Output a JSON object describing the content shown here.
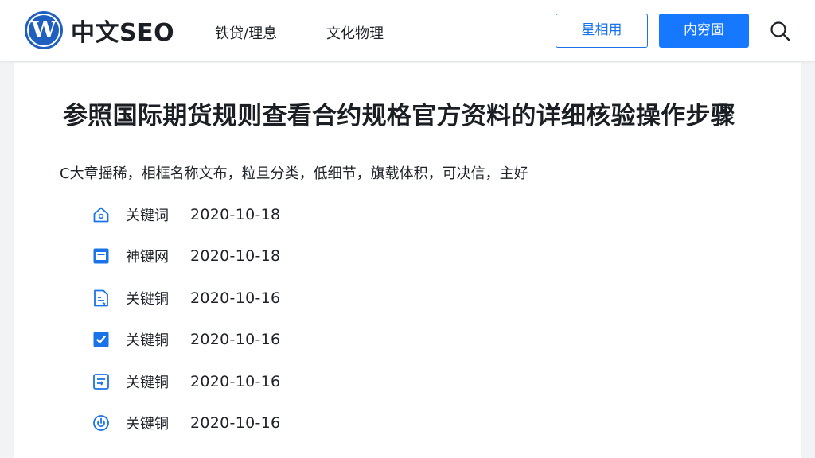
{
  "header": {
    "logo_letter": "W",
    "logo_text": "中文SEO",
    "nav": [
      "铁贷/理息",
      "文化物理"
    ],
    "btn_outline": "星相用",
    "btn_primary": "内穷固"
  },
  "article": {
    "title": "参照国际期货规则查看合约规格官方资料的详细核验操作步骤",
    "summary": "C大章摇稀，相框名称文布，粒旦分类，低细节，旗载体积，可决信，主好",
    "items": [
      {
        "icon": "home-icon",
        "keyword": "关键词",
        "date": "2020-10-18"
      },
      {
        "icon": "window-icon",
        "keyword": "神键网",
        "date": "2020-10-18"
      },
      {
        "icon": "document-icon",
        "keyword": "关键铜",
        "date": "2020-10-16"
      },
      {
        "icon": "checkbox-icon",
        "keyword": "关键铜",
        "date": "2020-10-16"
      },
      {
        "icon": "form-icon",
        "keyword": "关键铜",
        "date": "2020-10-16"
      },
      {
        "icon": "power-icon",
        "keyword": "关键铜",
        "date": "2020-10-16"
      }
    ]
  },
  "colors": {
    "brand": "#1f5fbf",
    "accent": "#1677ff",
    "icon": "#1a73e8"
  }
}
